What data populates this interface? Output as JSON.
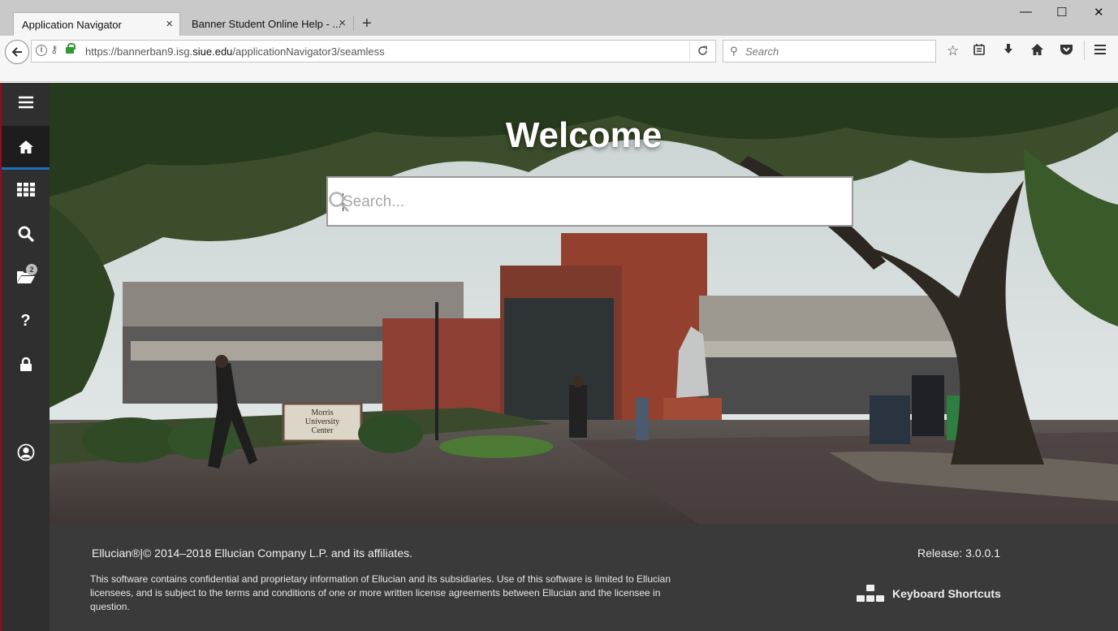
{
  "browser": {
    "tabs": [
      {
        "label": "Application Navigator",
        "active": true
      },
      {
        "label": "Banner Student Online Help - ...",
        "active": false
      }
    ],
    "new_tab_glyph": "+",
    "close_glyph": "×",
    "window_controls": {
      "minimize": "—",
      "maximize": "☐",
      "close": "✕"
    },
    "url_prefix": "https://bannerban9.isg.",
    "url_domain": "siue.edu",
    "url_path": "/applicationNavigator3/seamless",
    "search_placeholder": "Search",
    "toolbar_icons": [
      "star-icon",
      "reader-icon",
      "download-icon",
      "home-icon",
      "pocket-icon",
      "menu-icon"
    ]
  },
  "sidebar": {
    "items": [
      {
        "name": "menu",
        "icon": "hamburger-icon"
      },
      {
        "name": "home",
        "icon": "home-icon",
        "active": true
      },
      {
        "name": "applications",
        "icon": "grid-icon"
      },
      {
        "name": "search",
        "icon": "search-icon"
      },
      {
        "name": "recently-opened",
        "icon": "folder-icon",
        "badge": "2"
      },
      {
        "name": "help",
        "icon": "question-icon",
        "glyph": "?"
      },
      {
        "name": "sign-out",
        "icon": "lock-icon"
      },
      {
        "name": "profile",
        "icon": "user-icon"
      }
    ],
    "accent": "#1d6fb8",
    "edge_color": "#9b0a1c"
  },
  "hero": {
    "title": "Welcome",
    "search_placeholder": "Search...",
    "sign_text": [
      "Morris",
      "University",
      "Center"
    ]
  },
  "footer": {
    "copyright": "Ellucian®|© 2014–2018 Ellucian Company L.P. and its affiliates.",
    "release": "Release: 3.0.0.1",
    "legal": "This software contains confidential and proprietary information of Ellucian and its subsidiaries. Use of this software is limited to Ellucian licensees, and is subject to the terms and conditions of one or more written license agreements between Ellucian and the licensee in question.",
    "keyboard_shortcuts": "Keyboard Shortcuts"
  }
}
